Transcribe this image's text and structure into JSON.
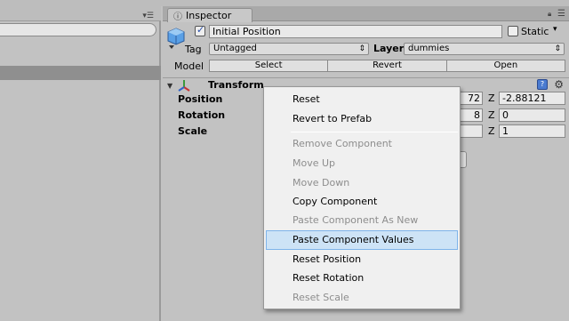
{
  "hierarchy": {
    "menu_icon": "window-menu-icon"
  },
  "inspector": {
    "tab_label": "Inspector",
    "tab_icon": "info-icon",
    "object": {
      "active": true,
      "name": "Initial Position",
      "static_label": "Static",
      "static_checked": false
    },
    "tag_label": "Tag",
    "tag_value": "Untagged",
    "layer_label": "Layer",
    "layer_value": "dummies",
    "model_label": "Model",
    "model_buttons": [
      "Select",
      "Revert",
      "Open"
    ],
    "component": {
      "title": "Transform",
      "rows": [
        {
          "label": "Position",
          "visible_y": "72",
          "z_label": "Z",
          "z_value": "-2.88121"
        },
        {
          "label": "Rotation",
          "visible_y": "8",
          "z_label": "Z",
          "z_value": "0"
        },
        {
          "label": "Scale",
          "visible_y": "",
          "z_label": "Z",
          "z_value": "1"
        }
      ]
    }
  },
  "context_menu": {
    "items": [
      {
        "label": "Reset",
        "enabled": true
      },
      {
        "label": "Revert to Prefab",
        "enabled": true
      },
      {
        "label": "Remove Component",
        "enabled": false
      },
      {
        "label": "Move Up",
        "enabled": false
      },
      {
        "label": "Move Down",
        "enabled": false
      },
      {
        "label": "Copy Component",
        "enabled": true
      },
      {
        "label": "Paste Component As New",
        "enabled": false
      },
      {
        "label": "Paste Component Values",
        "enabled": true,
        "highlighted": true
      },
      {
        "label": "Reset Position",
        "enabled": true
      },
      {
        "label": "Reset Rotation",
        "enabled": true
      },
      {
        "label": "Reset Scale",
        "enabled": false
      }
    ],
    "highlight_color": "#cde3f6"
  }
}
